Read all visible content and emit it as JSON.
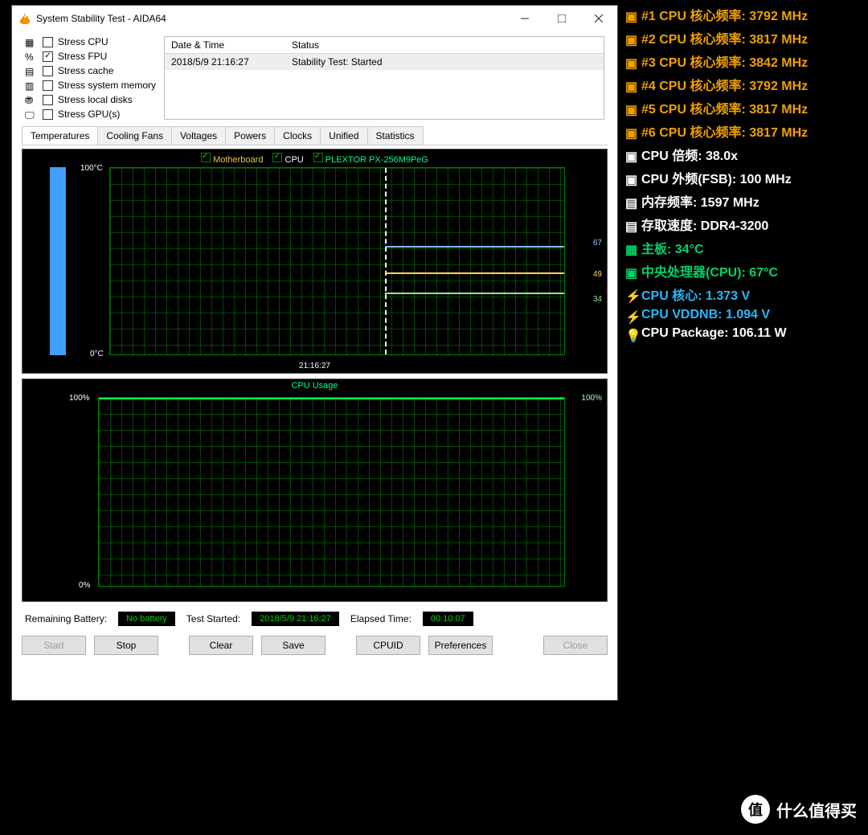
{
  "window": {
    "title": "System Stability Test - AIDA64"
  },
  "stress_options": [
    {
      "label": "Stress CPU",
      "checked": false,
      "icon": "cpu"
    },
    {
      "label": "Stress FPU",
      "checked": true,
      "icon": "fpu"
    },
    {
      "label": "Stress cache",
      "checked": false,
      "icon": "cache"
    },
    {
      "label": "Stress system memory",
      "checked": false,
      "icon": "memory"
    },
    {
      "label": "Stress local disks",
      "checked": false,
      "icon": "disk"
    },
    {
      "label": "Stress GPU(s)",
      "checked": false,
      "icon": "gpu"
    }
  ],
  "log": {
    "headers": {
      "dt": "Date & Time",
      "st": "Status"
    },
    "rows": [
      {
        "dt": "2018/5/9 21:16:27",
        "st": "Stability Test: Started"
      }
    ]
  },
  "tabs": [
    "Temperatures",
    "Cooling Fans",
    "Voltages",
    "Powers",
    "Clocks",
    "Unified",
    "Statistics"
  ],
  "active_tab": 0,
  "chart_temp": {
    "legend": [
      {
        "label": "Motherboard",
        "color": "#e0c84a"
      },
      {
        "label": "CPU",
        "color": "#ffffff"
      },
      {
        "label": "PLEXTOR PX-256M9PeG",
        "color": "#00ff88"
      }
    ],
    "ymin_label": "0°C",
    "ymax_label": "100°C",
    "xlabel": "21:16:27",
    "right_values": [
      {
        "v": "67",
        "pct": 34
      },
      {
        "v": "49",
        "pct": 52
      },
      {
        "v": "34",
        "pct": 67
      }
    ]
  },
  "chart_data": {
    "type": "line",
    "title": "CPU Usage",
    "ylabel": "",
    "ylim": [
      0,
      100
    ],
    "series": [
      {
        "name": "CPU Usage",
        "values": [
          100
        ]
      }
    ],
    "ymin_label": "0%",
    "ymax_label": "100%",
    "right_label": "100%"
  },
  "status": {
    "battery_label": "Remaining Battery:",
    "battery_value": "No battery",
    "started_label": "Test Started:",
    "started_value": "2018/5/9 21:16:27",
    "elapsed_label": "Elapsed Time:",
    "elapsed_value": "00:10:07"
  },
  "buttons": {
    "start": "Start",
    "stop": "Stop",
    "clear": "Clear",
    "save": "Save",
    "cpuid": "CPUID",
    "prefs": "Preferences",
    "close": "Close"
  },
  "sensors": [
    {
      "label": "#1 CPU 核心频率: 3792 MHz",
      "color": "#f0a000",
      "icon": "chip"
    },
    {
      "label": "#2 CPU 核心频率: 3817 MHz",
      "color": "#f0a000",
      "icon": "chip"
    },
    {
      "label": "#3 CPU 核心频率: 3842 MHz",
      "color": "#f0a000",
      "icon": "chip"
    },
    {
      "label": "#4 CPU 核心频率: 3792 MHz",
      "color": "#f0a000",
      "icon": "chip"
    },
    {
      "label": "#5 CPU 核心频率: 3817 MHz",
      "color": "#f0a000",
      "icon": "chip"
    },
    {
      "label": "#6 CPU 核心频率: 3817 MHz",
      "color": "#f0a000",
      "icon": "chip"
    },
    {
      "label": "CPU 倍频: 38.0x",
      "color": "#ffffff",
      "icon": "chip"
    },
    {
      "label": "CPU 外频(FSB): 100 MHz",
      "color": "#ffffff",
      "icon": "chip"
    },
    {
      "label": "内存频率: 1597 MHz",
      "color": "#ffffff",
      "icon": "mem"
    },
    {
      "label": "存取速度: DDR4-3200",
      "color": "#ffffff",
      "icon": "mem"
    },
    {
      "label": "主板: 34°C",
      "color": "#00d26a",
      "icon": "mobo"
    },
    {
      "label": "中央处理器(CPU): 67°C",
      "color": "#00d26a",
      "icon": "chip"
    },
    {
      "label": "CPU 核心: 1.373 V",
      "color": "#2ab7ff",
      "icon": "bolt"
    },
    {
      "label": "CPU VDDNB: 1.094 V",
      "color": "#2ab7ff",
      "icon": "bolt"
    },
    {
      "label": "CPU Package: 106.11 W",
      "color": "#ffffff",
      "icon": "bulb"
    }
  ],
  "watermark": "什么值得买"
}
